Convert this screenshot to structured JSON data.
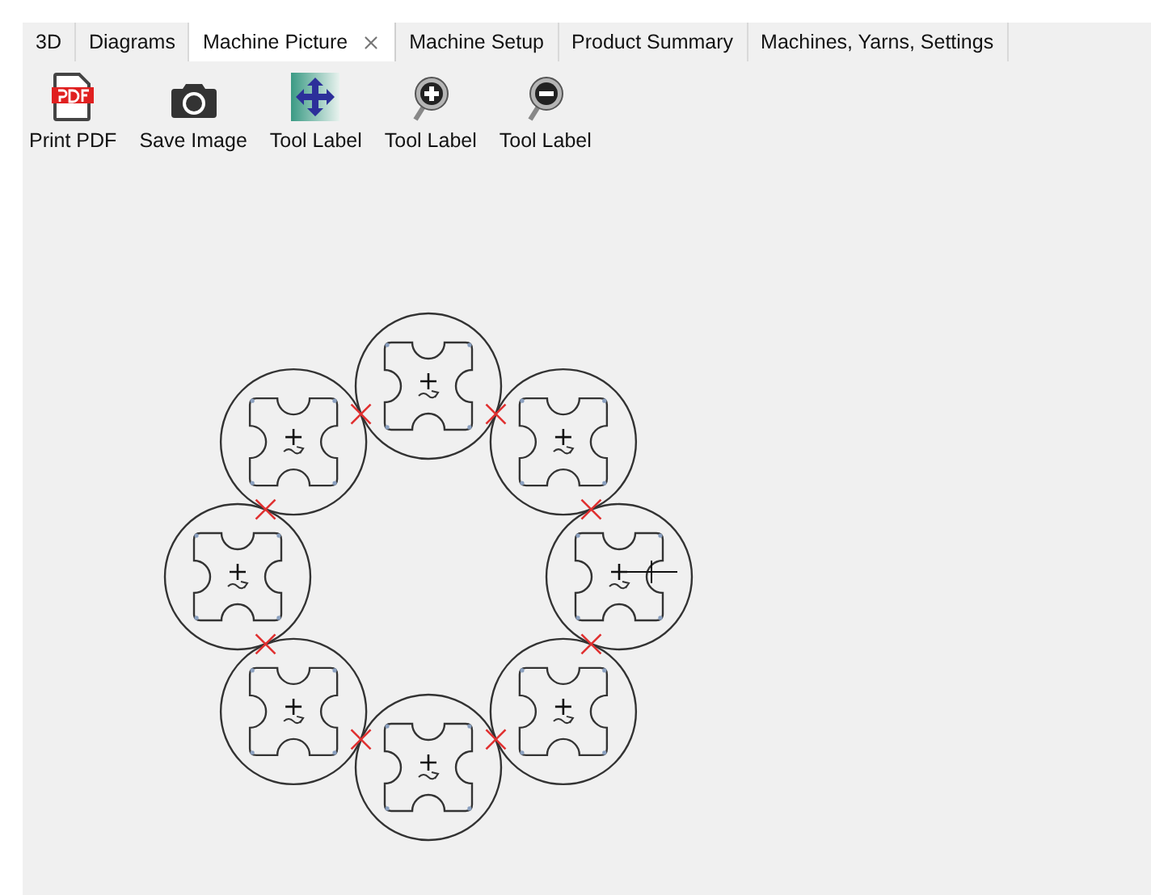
{
  "tabs": [
    {
      "label": "3D",
      "selected": false,
      "closable": false
    },
    {
      "label": "Diagrams",
      "selected": false,
      "closable": false
    },
    {
      "label": "Machine Picture",
      "selected": true,
      "closable": true
    },
    {
      "label": "Machine Setup",
      "selected": false,
      "closable": false
    },
    {
      "label": "Product Summary",
      "selected": false,
      "closable": false
    },
    {
      "label": "Machines, Yarns, Settings",
      "selected": false,
      "closable": false
    }
  ],
  "toolbar": [
    {
      "label": "Print PDF",
      "kind": "pdf"
    },
    {
      "label": "Save Image",
      "kind": "camera"
    },
    {
      "label": "Tool Label",
      "kind": "move"
    },
    {
      "label": "Tool Label",
      "kind": "zoom-in"
    },
    {
      "label": "Tool Label",
      "kind": "zoom-out"
    }
  ]
}
